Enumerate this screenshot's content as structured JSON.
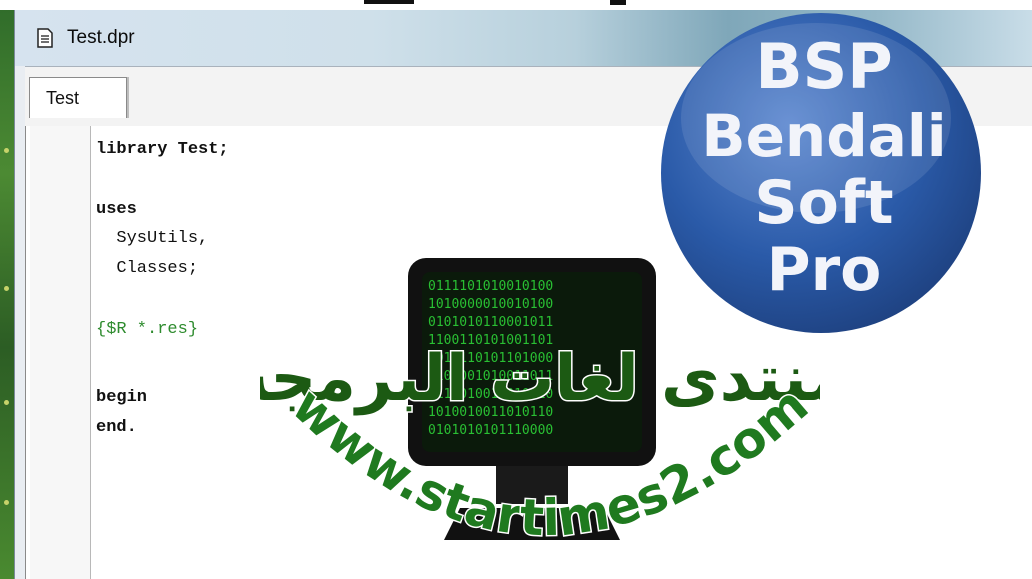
{
  "window": {
    "title": "Test.dpr",
    "tab_label": "Test"
  },
  "editor": {
    "lines": [
      {
        "text": "library Test;",
        "kind": "keyword"
      },
      {
        "text": "uses",
        "kind": "keyword"
      },
      {
        "text": "  SysUtils,",
        "kind": "plain"
      },
      {
        "text": "  Classes;",
        "kind": "plain"
      },
      {
        "text": "{$R *.res}",
        "kind": "comment"
      },
      {
        "text": "begin",
        "kind": "keyword"
      },
      {
        "text": "end.",
        "kind": "keyword"
      }
    ]
  },
  "logo": {
    "line1": "BSP",
    "line2": "Bendali",
    "line3": "Soft",
    "line4": "Pro",
    "color": "#2a5aa8"
  },
  "watermark": {
    "arabic_text": "منتدى لغات البرمجة",
    "url": "www.startimes2.com",
    "url_color": "#1f7a1f"
  },
  "colors": {
    "comment": "#2e8b2e",
    "desktop": "#3f7b2d"
  }
}
